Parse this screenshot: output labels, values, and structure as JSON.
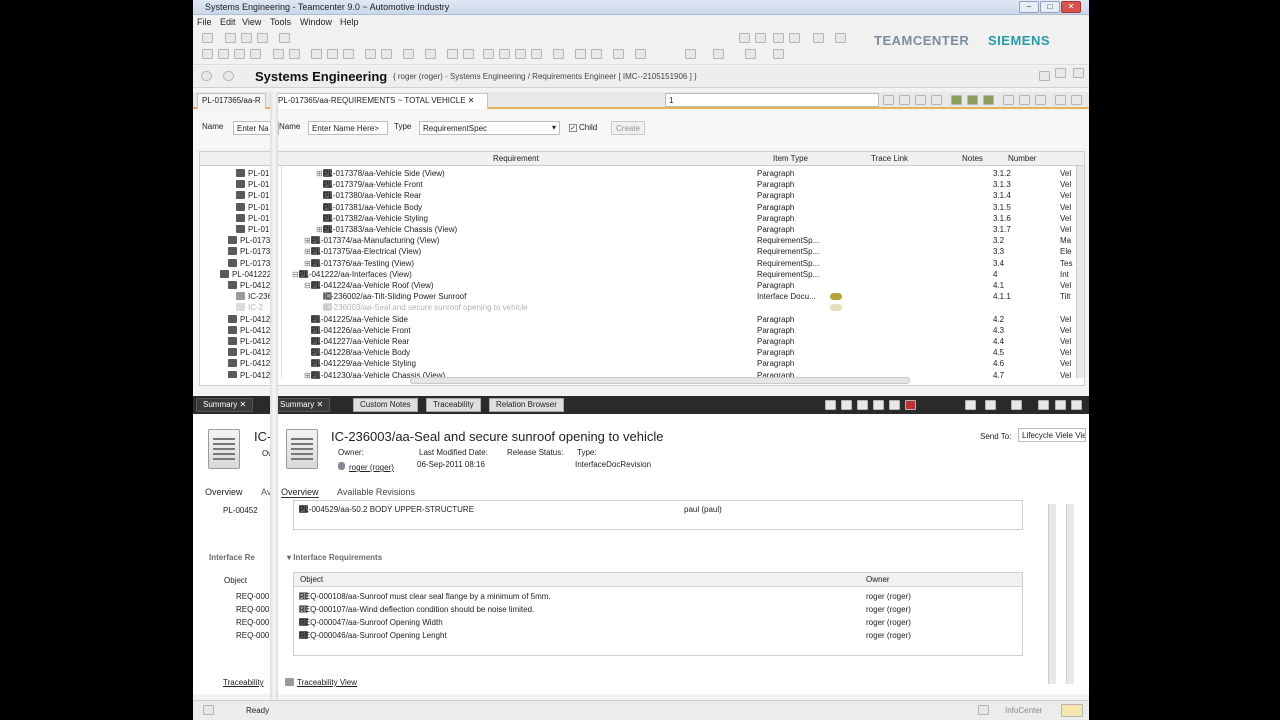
{
  "window": {
    "title": "Systems Engineering - Teamcenter 9.0 ~ Automotive Industry",
    "controls": [
      "–",
      "□",
      "✕"
    ]
  },
  "menu": [
    "File",
    "Edit",
    "View",
    "Tools",
    "Window",
    "Help"
  ],
  "brand": {
    "product": "TEAMCENTER",
    "company": "SIEMENS",
    "product_color": "#7d8c9c",
    "company_color": "#2a9aa8"
  },
  "perspective": {
    "title": "Systems Engineering",
    "info": "{ roger (roger) - Systems Engineering / Requirements Engineer  [ IMC--2105151906 ] }"
  },
  "editor_tabs": [
    {
      "label": "PL-017365/aa-R"
    },
    {
      "label": "PL-017365/aa-REQUIREMENTS ~ TOTAL VEHICLE"
    }
  ],
  "page_selector": "1",
  "search": {
    "name_label": "Name",
    "name_placeholder": "Enter Name Here>",
    "name_label2": "Name",
    "name_placeholder_short": "Enter Na",
    "type_label": "Type",
    "type_value": "RequirementSpec",
    "child_label": "Child",
    "create_label": "Create"
  },
  "grid": {
    "columns": [
      "Requirement",
      "Item Type",
      "Trace Link",
      "Notes",
      "Number"
    ],
    "rows": [
      {
        "req": "PL-017378/aa-Vehicle Side (View)",
        "type": "Paragraph",
        "number": "3.1.2",
        "extra": "Vel",
        "left": "PL-01",
        "exp": "⊞",
        "indent": 2
      },
      {
        "req": "PL-017379/aa-Vehicle Front",
        "type": "Paragraph",
        "number": "3.1.3",
        "extra": "Vel",
        "left": "PL-01",
        "exp": "",
        "indent": 2
      },
      {
        "req": "PL-017380/aa-Vehicle Rear",
        "type": "Paragraph",
        "number": "3.1.4",
        "extra": "Vel",
        "left": "PL-01",
        "exp": "",
        "indent": 2
      },
      {
        "req": "PL-017381/aa-Vehicle Body",
        "type": "Paragraph",
        "number": "3.1.5",
        "extra": "Vel",
        "left": "PL-01",
        "exp": "",
        "indent": 2
      },
      {
        "req": "PL-017382/aa-Vehicle Styling",
        "type": "Paragraph",
        "number": "3.1.6",
        "extra": "Vel",
        "left": "PL-01",
        "exp": "",
        "indent": 2
      },
      {
        "req": "PL-017383/aa-Vehicle Chassis (View)",
        "type": "Paragraph",
        "number": "3.1.7",
        "extra": "Vel",
        "left": "PL-01",
        "exp": "⊞",
        "indent": 2
      },
      {
        "req": "PL-017374/aa-Manufacturing (View)",
        "type": "RequirementSp...",
        "number": "3.2",
        "extra": "Ma",
        "left": "PL-0173",
        "exp": "⊞",
        "indent": 1
      },
      {
        "req": "PL-017375/aa-Electrical (View)",
        "type": "RequirementSp...",
        "number": "3.3",
        "extra": "Ele",
        "left": "PL-0173",
        "exp": "⊞",
        "indent": 1
      },
      {
        "req": "PL-017376/aa-Testing (View)",
        "type": "RequirementSp...",
        "number": "3.4",
        "extra": "Tes",
        "left": "PL-0173",
        "exp": "⊞",
        "indent": 1
      },
      {
        "req": "PL-041222/aa-Interfaces (View)",
        "type": "RequirementSp...",
        "number": "4",
        "extra": "Int",
        "left": "PL-041222/a",
        "exp": "⊟",
        "indent": 0
      },
      {
        "req": "PL-041224/aa-Vehicle Roof (View)",
        "type": "Paragraph",
        "number": "4.1",
        "extra": "Vel",
        "left": "PL-0412",
        "exp": "⊟",
        "indent": 1
      },
      {
        "req": "IC-236002/aa-Tilt-Sliding Power Sunroof",
        "type": "Interface Docu...",
        "number": "4.1.1",
        "extra": "Tilt",
        "left": "IC-236",
        "exp": "",
        "indent": 2,
        "link": true
      },
      {
        "req": "IC-236003/aa-Seal and secure sunroof opening to vehicle",
        "type": "",
        "number": "",
        "extra": "",
        "left": "IC-2",
        "exp": "",
        "indent": 2,
        "link": true,
        "ghost": true
      },
      {
        "req": "PL-041225/aa-Vehicle Side",
        "type": "Paragraph",
        "number": "4.2",
        "extra": "Vel",
        "left": "PL-0412",
        "exp": "",
        "indent": 1
      },
      {
        "req": "PL-041226/aa-Vehicle Front",
        "type": "Paragraph",
        "number": "4.3",
        "extra": "Vel",
        "left": "PL-0412",
        "exp": "",
        "indent": 1
      },
      {
        "req": "PL-041227/aa-Vehicle Rear",
        "type": "Paragraph",
        "number": "4.4",
        "extra": "Vel",
        "left": "PL-0412",
        "exp": "",
        "indent": 1
      },
      {
        "req": "PL-041228/aa-Vehicle Body",
        "type": "Paragraph",
        "number": "4.5",
        "extra": "Vel",
        "left": "PL-0412",
        "exp": "",
        "indent": 1
      },
      {
        "req": "PL-041229/aa-Vehicle Styling",
        "type": "Paragraph",
        "number": "4.6",
        "extra": "Vel",
        "left": "PL-0412",
        "exp": "",
        "indent": 1
      },
      {
        "req": "PL-041230/aa-Vehicle Chassis (View)",
        "type": "Paragraph",
        "number": "4.7",
        "extra": "Vel",
        "left": "PL-0412",
        "exp": "⊞",
        "indent": 1
      }
    ]
  },
  "bottom_tabs": [
    {
      "label": "Summary",
      "dark": true
    },
    {
      "label": "Summary",
      "dark": true
    },
    {
      "label": "Custom Notes",
      "dark": false
    },
    {
      "label": "Traceability",
      "dark": false
    },
    {
      "label": "Relation Browser",
      "dark": false
    }
  ],
  "summary": {
    "title": "IC-236003/aa-Seal and secure sunroof opening to vehicle",
    "title_short": "IC-",
    "owner_label": "Owner:",
    "owner_short": "Ow",
    "owner_value": "roger (roger)",
    "modified_label": "Last Modified Date:",
    "modified_value": "06-Sep-2011 08:16",
    "release_label": "Release Status:",
    "type_label": "Type:",
    "type_value": "InterfaceDocRevision",
    "send_to_label": "Send To:",
    "send_to_value": "Lifecycle Viele View",
    "subtabs": [
      "Overview",
      "Available Revisions"
    ],
    "subtab_short": "Av",
    "parent_row": {
      "object": "PL-004529/aa-50.2 BODY UPPER-STRUCTURE",
      "owner": "paul (paul)",
      "short": "PL-00452"
    },
    "section_title": "Interface Requirements",
    "section_title_short": "Interface Re",
    "table_headers": [
      "Object",
      "Owner"
    ],
    "requirements": [
      {
        "object": "REQ-000108/aa-Sunroof must clear seal flange by a minimum of 5mm.",
        "owner": "roger (roger)",
        "short": "REQ-000"
      },
      {
        "object": "REQ-000107/aa-Wind deflection condition should be noise limited.",
        "owner": "roger (roger)",
        "short": "REQ-000"
      },
      {
        "object": "REQ-000047/aa-Sunroof Opening Width",
        "owner": "roger (roger)",
        "short": "REQ-000"
      },
      {
        "object": "REQ-000046/aa-Sunroof Opening Lenght",
        "owner": "roger (roger)",
        "short": "REQ-000"
      }
    ],
    "traceability_link": "Traceability View",
    "traceability_short": "Traceability"
  },
  "status": {
    "text": "Ready",
    "infocenter": "InfoCenter"
  }
}
